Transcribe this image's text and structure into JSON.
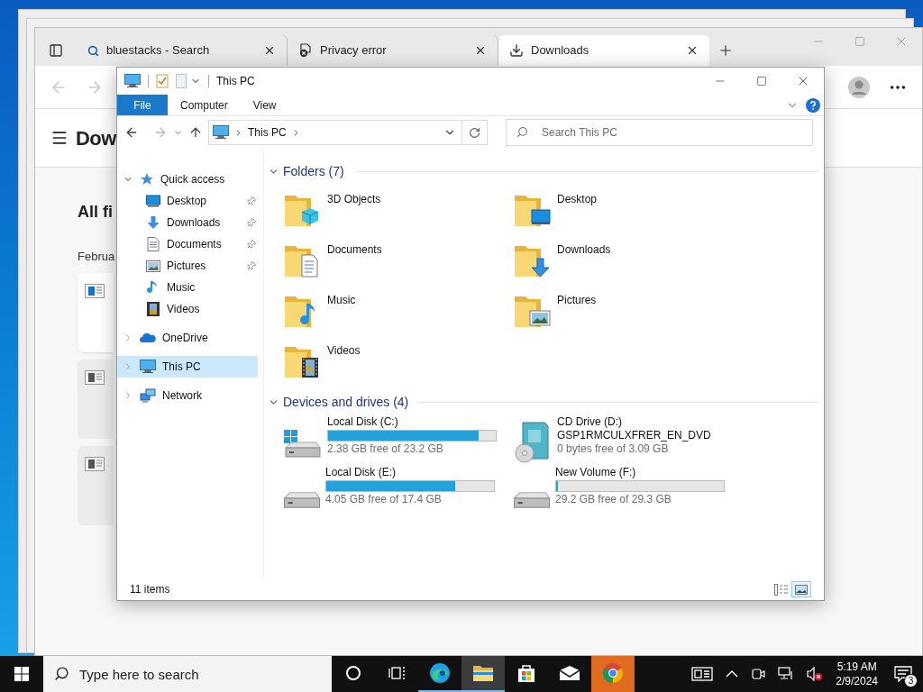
{
  "browser": {
    "tabs": [
      {
        "kind": "search",
        "title": "bluestacks - Search",
        "selected": false
      },
      {
        "kind": "error",
        "title": "Privacy error",
        "selected": false
      },
      {
        "kind": "download",
        "title": "Downloads",
        "selected": true
      }
    ],
    "page": {
      "heading": "Dow",
      "section": "All fi",
      "group": "Februa",
      "cards": [
        {
          "dimmed": false
        },
        {
          "dimmed": true
        },
        {
          "dimmed": true
        }
      ]
    }
  },
  "explorer": {
    "title": "This PC",
    "ribbon_tabs": [
      {
        "kind": "file",
        "label": "File"
      },
      {
        "kind": "tab",
        "label": "Computer"
      },
      {
        "kind": "tab",
        "label": "View"
      }
    ],
    "address": "This PC",
    "search": {
      "placeholder": "Search This PC"
    },
    "nav": [
      {
        "kind": "quick",
        "label": "Quick access",
        "expanded": true,
        "selected": false,
        "children": [
          {
            "kind": "desktop",
            "label": "Desktop",
            "pinned": true,
            "selected": false
          },
          {
            "kind": "downloads",
            "label": "Downloads",
            "pinned": true,
            "selected": false
          },
          {
            "kind": "documents",
            "label": "Documents",
            "pinned": true,
            "selected": false
          },
          {
            "kind": "pictures",
            "label": "Pictures",
            "pinned": true,
            "selected": false
          },
          {
            "kind": "music",
            "label": "Music",
            "pinned": false,
            "selected": false
          },
          {
            "kind": "videos",
            "label": "Videos",
            "pinned": false,
            "selected": false
          }
        ]
      },
      {
        "kind": "onedrive",
        "label": "OneDrive",
        "expanded": false,
        "selected": false
      },
      {
        "kind": "pc",
        "label": "This PC",
        "expanded": false,
        "selected": true
      },
      {
        "kind": "network",
        "label": "Network",
        "expanded": false,
        "selected": false
      }
    ],
    "groups": [
      {
        "kind": "folders",
        "title": "Folders (7)",
        "items": [
          {
            "kind": "objects",
            "name": "3D Objects"
          },
          {
            "kind": "desktop",
            "name": "Desktop"
          },
          {
            "kind": "documents",
            "name": "Documents"
          },
          {
            "kind": "downloads",
            "name": "Downloads"
          },
          {
            "kind": "music",
            "name": "Music"
          },
          {
            "kind": "pictures",
            "name": "Pictures"
          },
          {
            "kind": "videos",
            "name": "Videos"
          }
        ]
      },
      {
        "kind": "drives",
        "title": "Devices and drives (4)",
        "items": [
          {
            "kind": "system",
            "name": "Local Disk (C:)",
            "level": 0.9,
            "free": "2.38 GB free of 23.2 GB"
          },
          {
            "kind": "cd",
            "name": "CD Drive (D:)",
            "label": "GSP1RMCULXFRER_EN_DVD",
            "free": "0 bytes free of 3.09 GB"
          },
          {
            "kind": "disk",
            "name": "Local Disk (E:)",
            "level": 0.77,
            "free": "4.05 GB free of 17.4 GB"
          },
          {
            "kind": "disk",
            "name": "New Volume (F:)",
            "level": 0.01,
            "free": "29.2 GB free of 29.3 GB"
          }
        ]
      }
    ],
    "status": "11 items",
    "views": [
      {
        "kind": "details",
        "selected": false
      },
      {
        "kind": "large",
        "selected": true
      }
    ]
  },
  "taskbar": {
    "search_placeholder": "Type here to search",
    "apps": [
      {
        "kind": "cortana",
        "running": false,
        "active": false,
        "attention": false
      },
      {
        "kind": "taskview",
        "running": false,
        "active": false,
        "attention": false
      },
      {
        "kind": "edge",
        "running": true,
        "active": false,
        "attention": false
      },
      {
        "kind": "explorer",
        "running": true,
        "active": true,
        "attention": false
      },
      {
        "kind": "store",
        "running": false,
        "active": false,
        "attention": false
      },
      {
        "kind": "mail",
        "running": false,
        "active": false,
        "attention": false
      },
      {
        "kind": "chrome",
        "running": false,
        "active": false,
        "attention": true
      }
    ],
    "tray": [
      {
        "kind": "news"
      },
      {
        "kind": "chevron"
      },
      {
        "kind": "meet"
      },
      {
        "kind": "network"
      }
    ],
    "volume": {
      "muted": true
    },
    "time": "5:19 AM",
    "date": "2/9/2024",
    "notifications": "3"
  }
}
